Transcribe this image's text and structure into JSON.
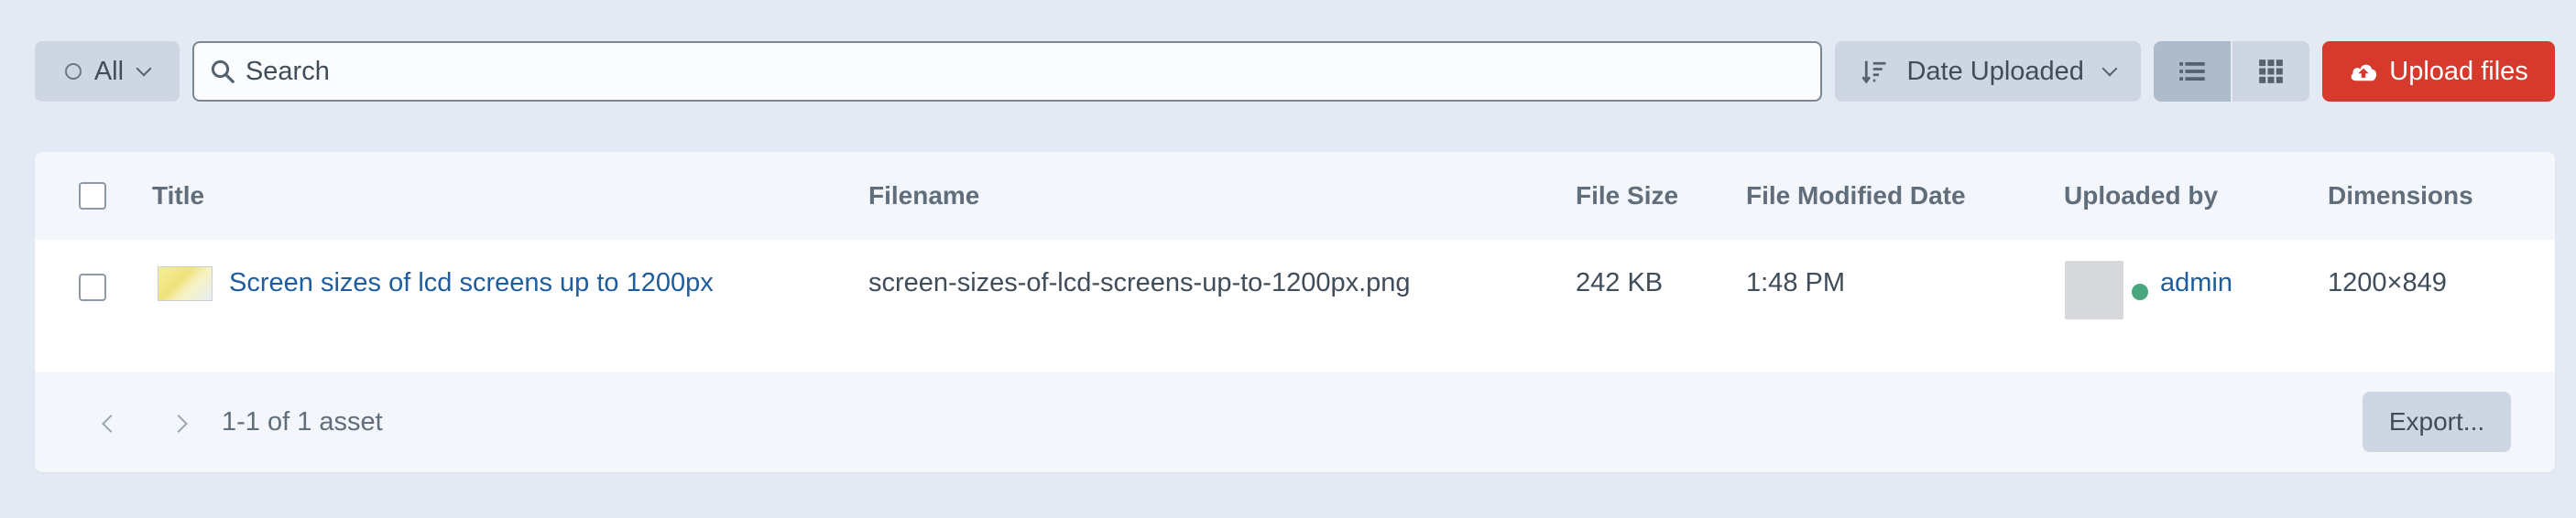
{
  "toolbar": {
    "filter_label": "All",
    "search_placeholder": "Search",
    "search_value": "",
    "sort_label": "Date Uploaded",
    "upload_label": "Upload files"
  },
  "table": {
    "columns": [
      "Title",
      "Filename",
      "File Size",
      "File Modified Date",
      "Uploaded by",
      "Dimensions"
    ],
    "rows": [
      {
        "title": "Screen sizes of lcd screens up to 1200px",
        "filename": "screen-sizes-of-lcd-screens-up-to-1200px.png",
        "file_size": "242 KB",
        "modified": "1:48 PM",
        "uploaded_by": "admin",
        "dimensions": "1200×849"
      }
    ]
  },
  "footer": {
    "pagination_text": "1-1 of 1 asset",
    "export_label": "Export..."
  },
  "colors": {
    "page_bg": "#e4eaf3",
    "upload_bg": "#d63a2c",
    "link": "#1f5d9c",
    "status_online": "#48a77c"
  },
  "icons": {
    "filter": "radio-ring-icon",
    "search": "search-icon",
    "sort": "sort-descending-icon",
    "list_view": "list-view-icon",
    "grid_view": "grid-view-icon",
    "upload": "cloud-upload-icon"
  }
}
